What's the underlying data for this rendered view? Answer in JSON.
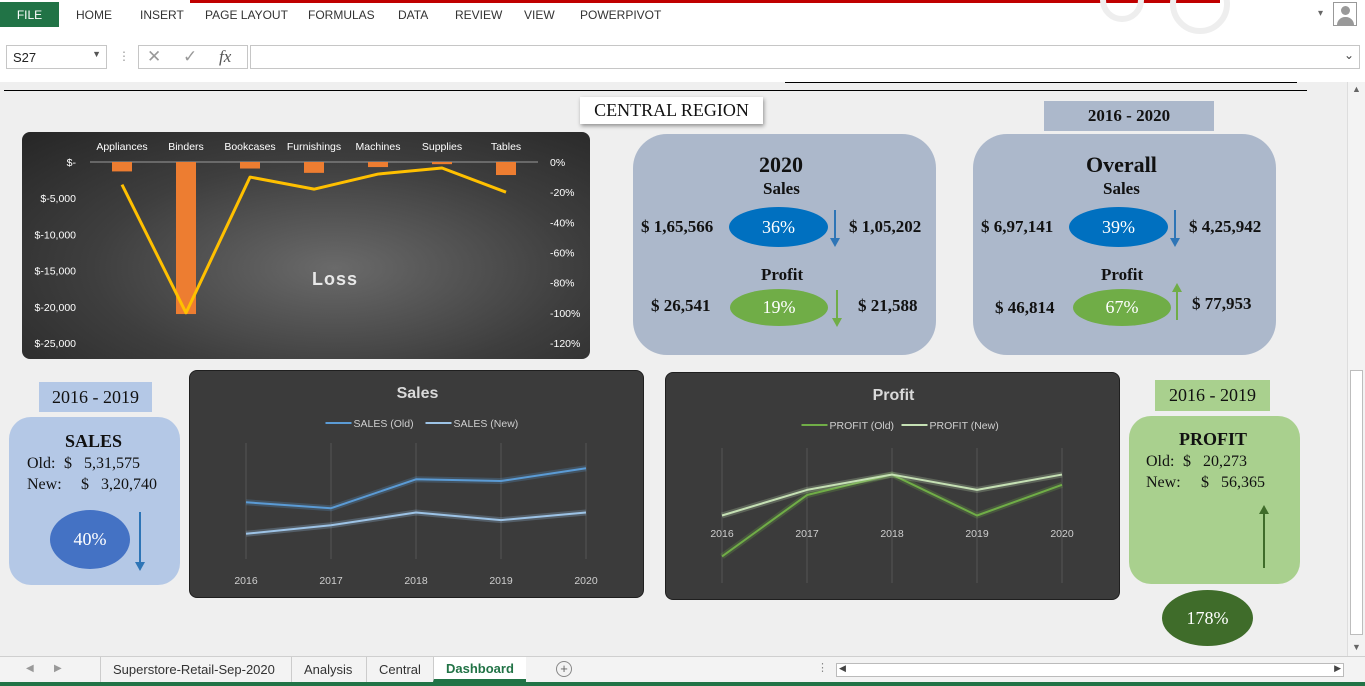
{
  "ribbon": {
    "file": "FILE",
    "tabs": [
      "HOME",
      "INSERT",
      "PAGE LAYOUT",
      "FORMULAS",
      "DATA",
      "REVIEW",
      "VIEW",
      "POWERPIVOT"
    ]
  },
  "formula_bar": {
    "name_box": "S27",
    "fx_label": "fx",
    "formula": ""
  },
  "dashboard": {
    "title": "CENTRAL REGION",
    "loss_chart": {
      "label": "Loss"
    },
    "card_2020": {
      "heading": "2020",
      "sales_label": "Sales",
      "sales_old": "$ 1,65,566",
      "sales_pct": "36%",
      "sales_new": "$ 1,05,202",
      "profit_label": "Profit",
      "profit_old": "$ 26,541",
      "profit_pct": "19%",
      "profit_new": "$ 21,588"
    },
    "period_overall": "2016 - 2020",
    "card_overall": {
      "heading": "Overall",
      "sales_label": "Sales",
      "sales_old": "$ 6,97,141",
      "sales_pct": "39%",
      "sales_new": "$ 4,25,942",
      "profit_label": "Profit",
      "profit_old": "$ 46,814",
      "profit_pct": "67%",
      "profit_new": "$ 77,953"
    },
    "period_sales": "2016 - 2019",
    "sales_card": {
      "heading": "SALES",
      "old_label": "Old:",
      "old_value": "$   5,31,575",
      "new_label": "New:",
      "new_value": "$   3,20,740",
      "pct": "40%"
    },
    "period_profit": "2016 - 2019",
    "profit_card": {
      "heading": "PROFIT",
      "old_label": "Old:",
      "old_value": "$   20,273",
      "new_label": "New:",
      "new_value": "$   56,365",
      "pct": "178%"
    }
  },
  "colors": {
    "excel_green": "#217346",
    "card_blue": "#acb8cb",
    "oval_blue": "#0070c0",
    "oval_green": "#70ad47",
    "oval_darkgreen": "#3f6c2a",
    "loss_bar": "#ed7d31",
    "loss_line": "#ffc000"
  },
  "sheet_tabs": [
    "Superstore-Retail-Sep-2020",
    "Analysis",
    "Central",
    "Dashboard"
  ],
  "active_sheet": "Dashboard",
  "chart_data": [
    {
      "type": "bar",
      "categories": [
        "Appliances",
        "Binders",
        "Bookcases",
        "Furnishings",
        "Machines",
        "Supplies",
        "Tables"
      ],
      "series": [
        {
          "values": [
            -1300,
            -21000,
            -900,
            -1500,
            -700,
            -300,
            -1800
          ]
        },
        {
          "values": [
            -15,
            -100,
            -10,
            -18,
            -8,
            -4,
            -20
          ]
        }
      ],
      "y_ticks_left": [
        "$-",
        "$-5,000",
        "$-10,000",
        "$-15,000",
        "$-20,000",
        "$-25,000"
      ],
      "y_ticks_right": [
        "0%",
        "-20%",
        "-40%",
        "-60%",
        "-80%",
        "-100%",
        "-120%"
      ],
      "ylim": [
        -25000,
        0
      ],
      "ylim_right": [
        -120,
        0
      ],
      "legend": "none"
    },
    {
      "type": "line",
      "title": "Sales",
      "x": [
        "2016",
        "2017",
        "2018",
        "2019",
        "2020"
      ],
      "series": [
        {
          "name": "SALES (Old)",
          "color": "#5b9bd5",
          "values": [
            85000,
            78000,
            112000,
            110000,
            125000
          ]
        },
        {
          "name": "SALES (New)",
          "color": "#9dc3e6",
          "values": [
            48000,
            58000,
            73000,
            64000,
            73000
          ]
        }
      ],
      "legend": "top"
    },
    {
      "type": "line",
      "title": "Profit",
      "x": [
        "2016",
        "2017",
        "2018",
        "2019",
        "2020"
      ],
      "series": [
        {
          "name": "PROFIT (Old)",
          "color": "#70ad47",
          "values": [
            -2000,
            10000,
            14000,
            6000,
            12000
          ]
        },
        {
          "name": "PROFIT (New)",
          "color": "#c5e0b4",
          "values": [
            6000,
            11000,
            14000,
            11000,
            14000
          ]
        }
      ],
      "legend": "top"
    }
  ]
}
